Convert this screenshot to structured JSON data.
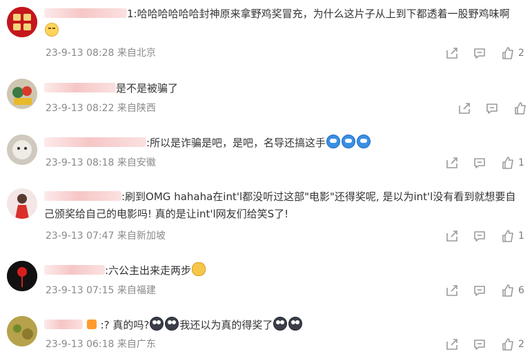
{
  "colors": {
    "text": "#333333",
    "meta": "#8a8a8a",
    "icon": "#9a9a9a",
    "redacted_name": "#f6c6c6"
  },
  "icons": {
    "share": "share-icon",
    "comment": "comment-icon",
    "like": "thumbs-up-icon"
  },
  "comments": [
    {
      "name_suffix": "1",
      "text_before": ":哈哈哈哈哈哈封神原来拿野鸡奖冒充，为什么这片子从上到下都透着一股野鸡味啊",
      "text_after": "",
      "meta": "23-9-13 08:28 来自北京",
      "likes": "2"
    },
    {
      "name_suffix": "",
      "text_before": "是不是被骗了",
      "text_after": "",
      "meta": "23-9-13 08:22 来自陕西",
      "likes": ""
    },
    {
      "name_suffix": "",
      "text_before": ":所以是诈骗是吧，是吧，名导还搞这手",
      "text_after": "",
      "meta": "23-9-13 08:18 来自安徽",
      "likes": "1"
    },
    {
      "name_suffix": "",
      "text_before": ":刷到OMG hahaha在int'l都没听过这部\"电影\"还得奖呢, 是以为int'l没有看到就想要自己颁奖给自己的电影吗! 真的是让int'l网友们给笑S了!",
      "text_after": "",
      "meta": "23-9-13 07:47 来自新加坡",
      "likes": "1"
    },
    {
      "name_suffix": "",
      "text_before": ":六公主出来走两步",
      "text_after": "",
      "meta": "23-9-13 07:15 来自福建",
      "likes": "6"
    },
    {
      "name_suffix": "",
      "text_before": ":?  真的吗?",
      "text_after": "我还以为真的得奖了",
      "meta": "23-9-13 06:18 来自广东",
      "likes": "2"
    }
  ]
}
